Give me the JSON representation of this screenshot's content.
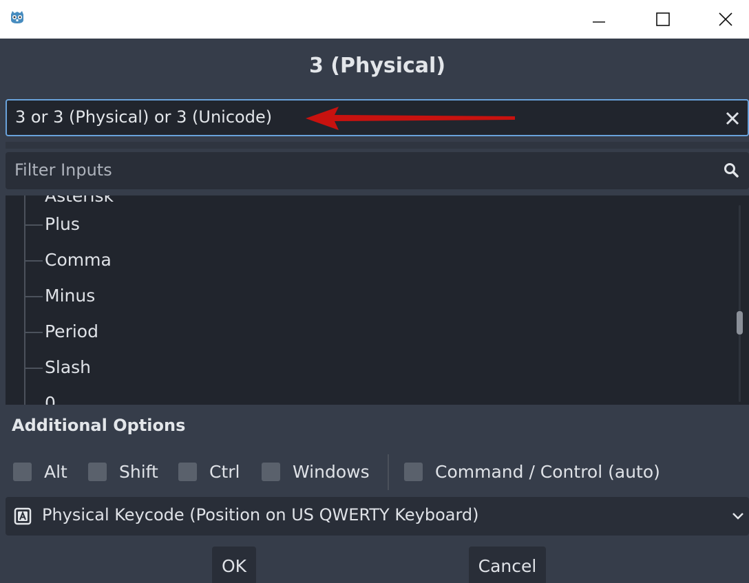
{
  "window": {
    "icon": "godot-icon",
    "controls": [
      "minimize-icon",
      "maximize-icon",
      "close-icon"
    ]
  },
  "dialog": {
    "title": "3 (Physical)",
    "event_field": {
      "value": "3 or 3 (Physical) or 3 (Unicode)",
      "clear_icon": "clear-x-icon",
      "annotation": "red-arrow-icon",
      "annotation_color": "#c8120f"
    },
    "filter": {
      "placeholder": "Filter Inputs",
      "icon": "search-icon"
    },
    "tree": {
      "partial_top": "Asterisk",
      "items": [
        "Plus",
        "Comma",
        "Minus",
        "Period",
        "Slash"
      ],
      "partial_bottom": "0"
    },
    "additional_options": {
      "title": "Additional Options",
      "modifiers": [
        "Alt",
        "Shift",
        "Ctrl",
        "Windows"
      ],
      "command_control": "Command / Control (auto)"
    },
    "keycode_select": {
      "value": "Physical Keycode (Position on US QWERTY Keyboard)",
      "icon": "keyboard-key-icon"
    },
    "buttons": {
      "ok": "OK",
      "cancel": "Cancel"
    }
  },
  "colors": {
    "background": "#363d4a",
    "field_bg": "#21252d",
    "focus_border": "#6aa3dc",
    "checkbox": "#5a616c"
  }
}
